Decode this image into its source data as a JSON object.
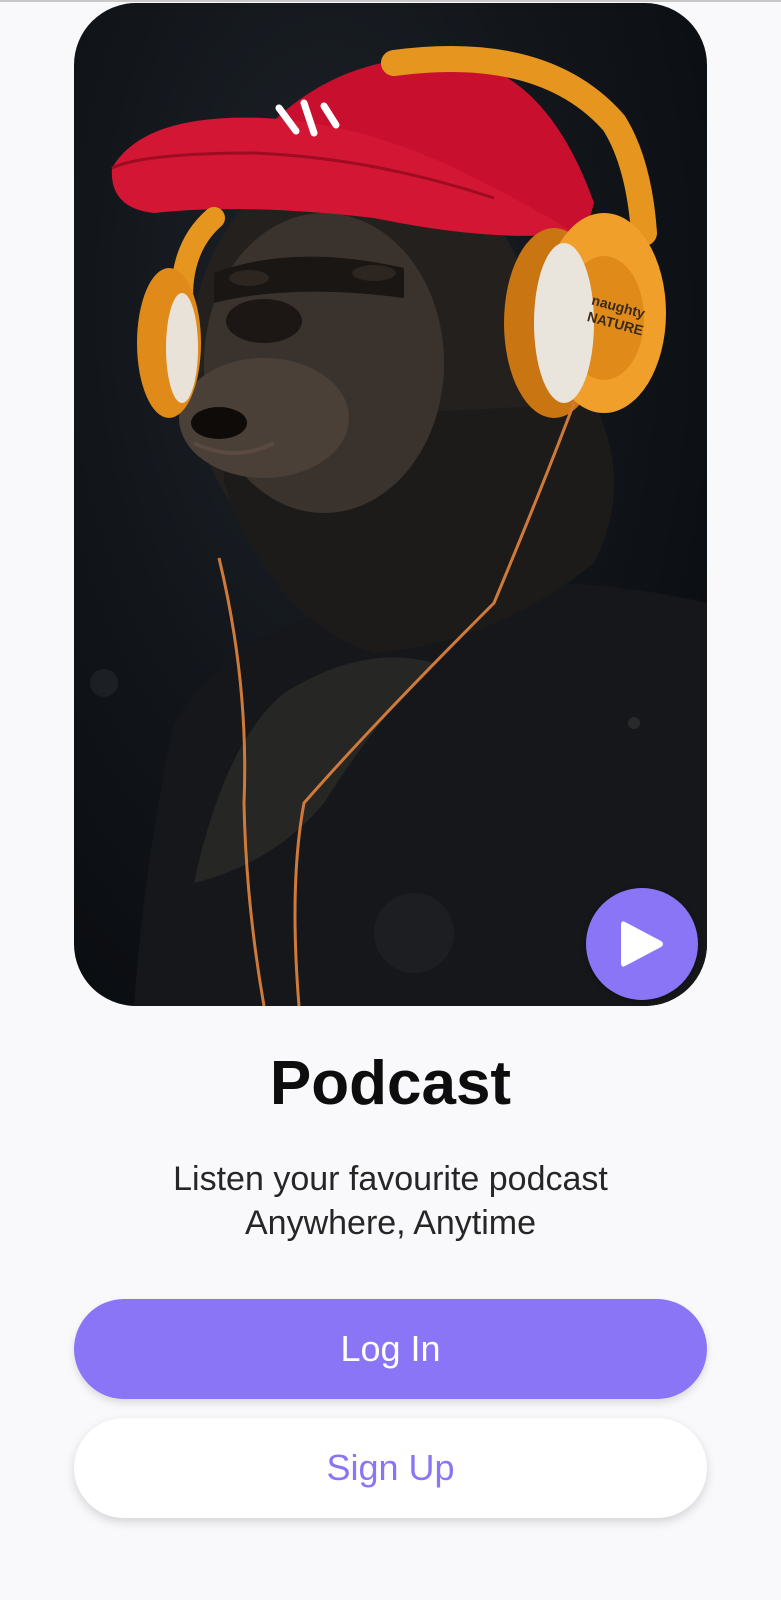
{
  "hero": {
    "image_alt": "Gorilla wearing red cap and orange headphones",
    "headphone_brand": "Naughty by Nature"
  },
  "play_button": {
    "icon": "play-icon",
    "color": "#8a75f7"
  },
  "title": "Podcast",
  "subtitle": {
    "line1": "Listen your favourite podcast",
    "line2": "Anywhere, Anytime"
  },
  "buttons": {
    "login_label": "Log In",
    "signup_label": "Sign Up"
  },
  "colors": {
    "accent": "#8a75f7",
    "background": "#f9f9fb"
  }
}
